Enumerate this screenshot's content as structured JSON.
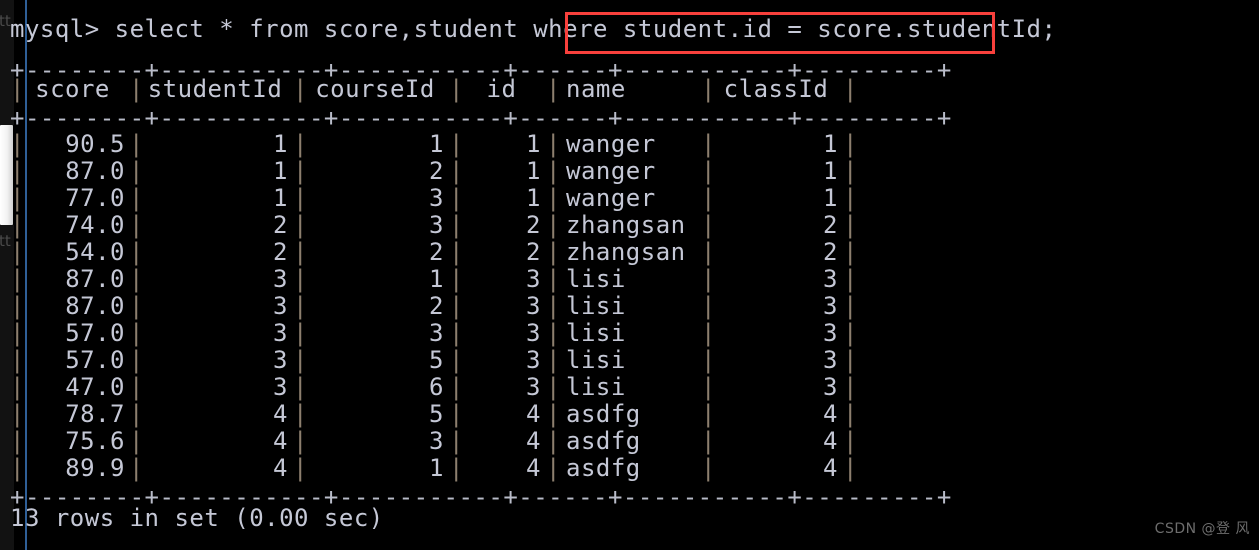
{
  "terminal": {
    "prompt": "mysql> select * from score,student where student.id = score.studentId;",
    "footer": "13 rows in set (0.00 sec)",
    "rule_top": "+--------+-----------+-----------+------+-----------+---------+",
    "rule_mid": "+--------+-----------+-----------+------+-----------+---------+",
    "rule_bottom": "+--------+-----------+-----------+------+-----------+---------+",
    "pipe": "|",
    "colors": {
      "background": "#000000",
      "text": "#c5c8d6",
      "rule": "#b9bcc9",
      "pipe": "#8d7f6e",
      "highlight": "#f8403c",
      "window_border": "#2f5f97"
    }
  },
  "highlight": {
    "target_text": "student.id = score.studentId;"
  },
  "result_table": {
    "columns": [
      {
        "key": "score",
        "label": "score"
      },
      {
        "key": "studentId",
        "label": "studentId"
      },
      {
        "key": "courseId",
        "label": "courseId"
      },
      {
        "key": "id",
        "label": "id"
      },
      {
        "key": "name",
        "label": "name"
      },
      {
        "key": "classId",
        "label": "classId"
      }
    ],
    "rows": [
      {
        "score": "90.5",
        "studentId": "1",
        "courseId": "1",
        "id": "1",
        "name": "wanger",
        "classId": "1"
      },
      {
        "score": "87.0",
        "studentId": "1",
        "courseId": "2",
        "id": "1",
        "name": "wanger",
        "classId": "1"
      },
      {
        "score": "77.0",
        "studentId": "1",
        "courseId": "3",
        "id": "1",
        "name": "wanger",
        "classId": "1"
      },
      {
        "score": "74.0",
        "studentId": "2",
        "courseId": "3",
        "id": "2",
        "name": "zhangsan",
        "classId": "2"
      },
      {
        "score": "54.0",
        "studentId": "2",
        "courseId": "2",
        "id": "2",
        "name": "zhangsan",
        "classId": "2"
      },
      {
        "score": "87.0",
        "studentId": "3",
        "courseId": "1",
        "id": "3",
        "name": "lisi",
        "classId": "3"
      },
      {
        "score": "87.0",
        "studentId": "3",
        "courseId": "2",
        "id": "3",
        "name": "lisi",
        "classId": "3"
      },
      {
        "score": "57.0",
        "studentId": "3",
        "courseId": "3",
        "id": "3",
        "name": "lisi",
        "classId": "3"
      },
      {
        "score": "57.0",
        "studentId": "3",
        "courseId": "5",
        "id": "3",
        "name": "lisi",
        "classId": "3"
      },
      {
        "score": "47.0",
        "studentId": "3",
        "courseId": "6",
        "id": "3",
        "name": "lisi",
        "classId": "3"
      },
      {
        "score": "78.7",
        "studentId": "4",
        "courseId": "5",
        "id": "4",
        "name": "asdfg",
        "classId": "4"
      },
      {
        "score": "75.6",
        "studentId": "4",
        "courseId": "3",
        "id": "4",
        "name": "asdfg",
        "classId": "4"
      },
      {
        "score": "89.9",
        "studentId": "4",
        "courseId": "1",
        "id": "4",
        "name": "asdfg",
        "classId": "4"
      }
    ],
    "row_count": 13
  },
  "window_chrome": {
    "ghost_top": "tt",
    "ghost_bottom": "tt"
  },
  "watermark": {
    "text": "CSDN @登 风"
  }
}
